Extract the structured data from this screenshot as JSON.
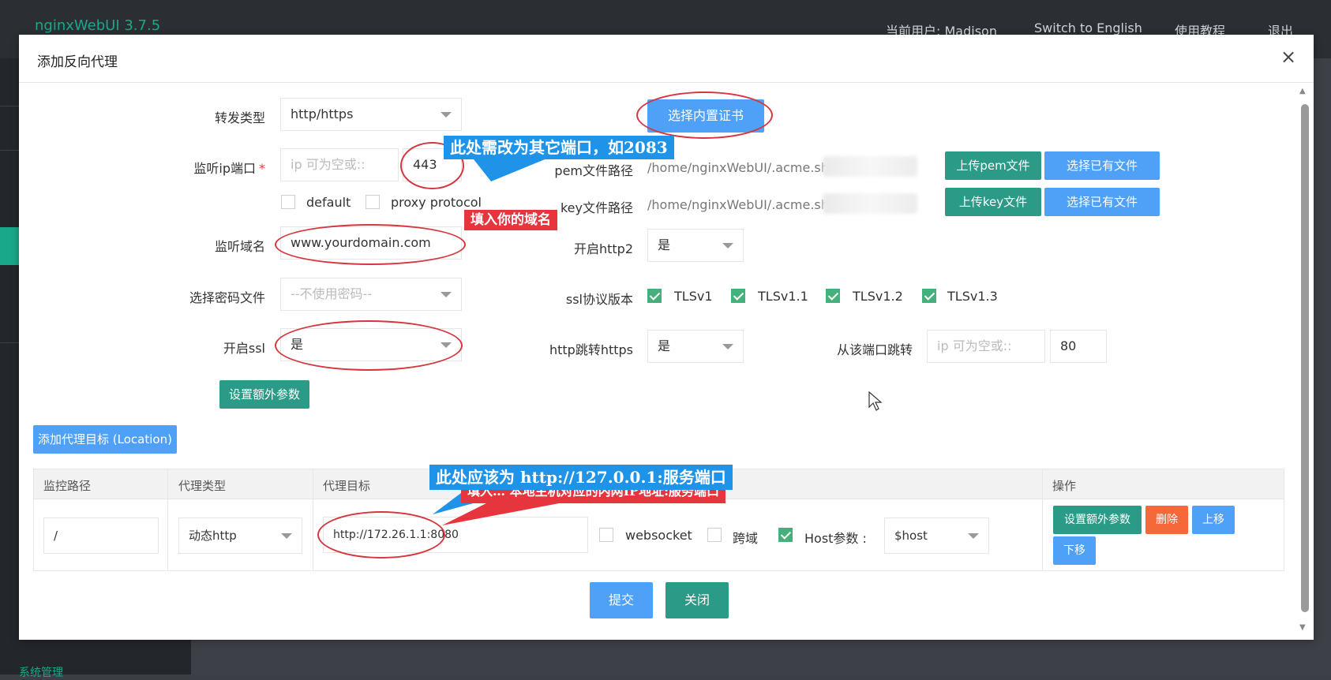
{
  "app": {
    "title": "nginxWebUI 3.7.5",
    "current_user": "当前用户: Madison",
    "switch_lang": "Switch to English",
    "tutorial": "使用教程",
    "logout": "退出",
    "sidebar_bottom": "系统管理"
  },
  "modal": {
    "title": "添加反向代理",
    "close": "×",
    "forward_type_label": "转发类型",
    "forward_type_value": "http/https",
    "choose_builtin_cert": "选择内置证书",
    "listen_port_label": "监听ip端口",
    "listen_ip_placeholder": "ip 可为空或::",
    "listen_port_value": "443",
    "default_label": "default",
    "proxy_protocol_label": "proxy protocol",
    "pem_label": "pem文件路径",
    "pem_value": "/home/nginxWebUI/.acme.sh/",
    "upload_pem": "上传pem文件",
    "choose_existing_1": "选择已有文件",
    "key_label": "key文件路径",
    "key_value": "/home/nginxWebUI/.acme.sh/",
    "upload_key": "上传key文件",
    "choose_existing_2": "选择已有文件",
    "domain_label": "监听域名",
    "domain_value": "www.yourdomain.com",
    "http2_label": "开启http2",
    "http2_value": "是",
    "password_label": "选择密码文件",
    "password_value": "--不使用密码--",
    "ssl_version_label": "ssl协议版本",
    "tls": [
      "TLSv1",
      "TLSv1.1",
      "TLSv1.2",
      "TLSv1.3"
    ],
    "ssl_label": "开启ssl",
    "ssl_value": "是",
    "http_redirect_label": "http跳转https",
    "http_redirect_value": "是",
    "redirect_from_label": "从该端口跳转",
    "redirect_ip_placeholder": "ip 可为空或::",
    "redirect_port_value": "80",
    "extra_params": "设置额外参数",
    "add_location": "添加代理目标 (Location)",
    "submit": "提交",
    "close_btn": "关闭"
  },
  "location_table": {
    "headers": [
      "监控路径",
      "代理类型",
      "代理目标",
      "操作"
    ],
    "row": {
      "path": "/",
      "proxy_type": "动态http",
      "target": "http://172.26.1.1:8080",
      "websocket": "websocket",
      "cors": "跨域",
      "host_param_label": "Host参数 :",
      "host_value": "$host",
      "extra_params": "设置额外参数",
      "delete": "删除",
      "move_up": "上移",
      "move_down": "下移"
    }
  },
  "annotations": {
    "port_note": "此处需改为其它端口，如2083",
    "domain_note": "填入你的域名",
    "target_note": "此处应该为 http://127.0.0.1:服务端口",
    "target_note_hidden": "填入… 本地主机对应的内网IP地址:服务端口"
  },
  "colors": {
    "accent_blue": "#4fa1f7",
    "accent_teal": "#2b9a86",
    "danger": "#f4683a",
    "annotation_red": "#d6363d",
    "annotation_blue": "#1f93e8"
  }
}
